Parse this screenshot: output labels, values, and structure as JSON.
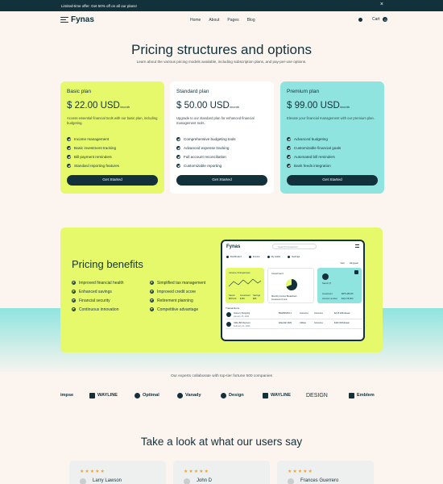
{
  "announcement": {
    "text": "Limited-time offer: Get 50% off on all our plans!",
    "close": "×"
  },
  "nav": {
    "brand": "Fynas",
    "links": [
      "Home",
      "About",
      "Pages",
      "Blog"
    ],
    "cart_label": "Cart",
    "cart_count": "0"
  },
  "hero": {
    "title": "Pricing structures and options",
    "subtitle": "Learn about the various pricing models available, including subscription plans, and pay-per-use options."
  },
  "plans": [
    {
      "name": "Basic plan",
      "price": "$ 22.00 USD",
      "period": "/month",
      "description": "Access essential financial tools with our basic plan, including budgeting.",
      "features": [
        "Income management",
        "Basic investment tracking",
        "Bill payment reminders",
        "Standard reporting features"
      ],
      "cta": "Get Started",
      "color": "#e5f96b"
    },
    {
      "name": "Standard plan",
      "price": "$ 50.00 USD",
      "period": "/month",
      "description": "Upgrade to our standard plan for enhanced financial management tools.",
      "features": [
        "Comprehensive budgeting tools",
        "Advanced expense tracking",
        "Full account reconciliation",
        "Customizable reporting"
      ],
      "cta": "Get Started",
      "color": "#ffffff"
    },
    {
      "name": "Premium plan",
      "price": "$ 99.00 USD",
      "period": "/month",
      "description": "Elevate your financial management with our premium plan.",
      "features": [
        "Advanced budgeting",
        "Customizable financial goals",
        "Automated bill reminders",
        "Bank feeds integration"
      ],
      "cta": "Get Started",
      "color": "#8fe4df"
    }
  ],
  "benefits": {
    "title": "Pricing benefits",
    "left": [
      "Improved financial health",
      "Enhanced savings",
      "Financial security",
      "Continuous innovation"
    ],
    "right": [
      "Simplified tax management",
      "Improved credit score",
      "Retirement planning",
      "Competitive advantage"
    ]
  },
  "dashboard": {
    "brand": "Fynas",
    "search_placeholder": "Search transaction",
    "tabs": [
      "Dashboard",
      "Invoice",
      "My wallet",
      "Settings"
    ],
    "period": [
      "Year",
      "Hingyear"
    ],
    "tiles": {
      "income": "Income & Expenses",
      "investment": "Investment",
      "investment_items": [
        "Monthly Invoice Breakdown",
        "Investment Fund"
      ],
      "wallet": "Saved (?)",
      "wallet_items": [
        "Investment",
        "$879,356.89",
        "Account number",
        "$43,178,000"
      ],
      "income_stats": [
        "Saved",
        "$879.00",
        "Investment",
        "$150",
        "Savings",
        "$85"
      ]
    },
    "transactions_title": "Transactions",
    "transactions": [
      {
        "name": "Grocery Shopping",
        "date": "January 15, 2024",
        "id": "BW4856253-1",
        "cat": "Groceries",
        "status": "Groceries",
        "amt": "$3.25 Withdrawal"
      },
      {
        "name": "Utility Bill Payment",
        "date": "February 01, 2024",
        "id": "Waterfall 4025",
        "cat": "Utilities",
        "status": "Groceries",
        "amt": "$100 Withdrawal"
      }
    ]
  },
  "collaborate": "Our experts collaborate with top-tier fortune 500 companies",
  "partner_logos": [
    "impse",
    "WAYLINE",
    "Optimal",
    "Vanady",
    "Design",
    "WAYLINE",
    "DESIGN",
    "Emblem"
  ],
  "testimonials": {
    "title": "Take a look at what our users say",
    "stars": "★★★★★",
    "people": [
      "Larry Lawson",
      "John D",
      "Frances Guerrero"
    ]
  }
}
